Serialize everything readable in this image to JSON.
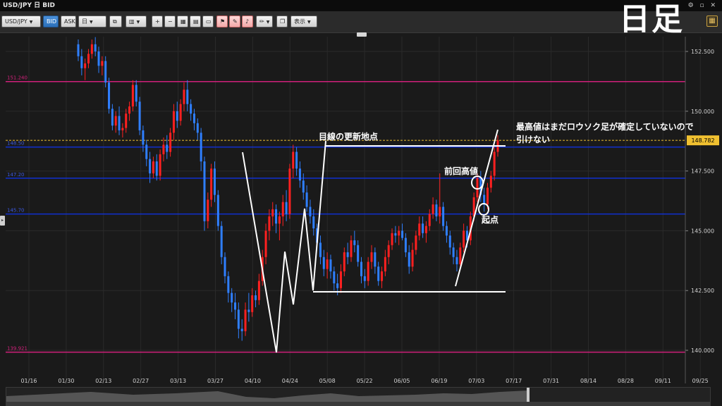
{
  "window": {
    "title": "USD/JPY 日 BID",
    "controls": "⚙ ▫ ✕"
  },
  "toolbar": {
    "pair": "USD/JPY",
    "bid": "BID",
    "ask": "ASK",
    "timeframe": "日",
    "display_label": "表示"
  },
  "corner_label": "日足",
  "annotations": {
    "note_line1": "最高値はまだロウソク足が確定していないので",
    "note_line2": "引けない",
    "update_point": "目線の更新地点",
    "prev_high": "前回高値",
    "start_point": "起点"
  },
  "colors": {
    "background": "#1a1a1a",
    "grid": "#2a2a2a",
    "bull": "#ff2020",
    "bear": "#2f7fff",
    "magenta_line": "#d0207a",
    "blue_line": "#1030d0",
    "current_price": "#f0c030",
    "drawing": "#ffffff"
  },
  "chart_data": {
    "type": "candlestick",
    "symbol": "USD/JPY",
    "timeframe": "日",
    "y_axis": {
      "ticks": [
        "152.500",
        "150.000",
        "147.500",
        "145.000",
        "142.500",
        "140.000"
      ],
      "range": [
        139.0,
        153.2
      ]
    },
    "x_axis": {
      "ticks": [
        "01/16",
        "01/30",
        "02/13",
        "02/27",
        "03/13",
        "03/27",
        "04/10",
        "04/24",
        "05/08",
        "05/22",
        "06/05",
        "06/19",
        "07/03",
        "07/17",
        "07/31",
        "08/14",
        "08/28",
        "09/11",
        "09/25"
      ]
    },
    "horizontal_lines": [
      {
        "label": "151.240",
        "value": 151.24,
        "color": "magenta"
      },
      {
        "label": "148.782",
        "value": 148.782,
        "color": "current-price"
      },
      {
        "label": "148.50",
        "value": 148.5,
        "color": "blue"
      },
      {
        "label": "147.20",
        "value": 147.2,
        "color": "blue"
      },
      {
        "label": "145.70",
        "value": 145.7,
        "color": "blue"
      },
      {
        "label": "139.921",
        "value": 139.921,
        "color": "magenta"
      }
    ],
    "current_price": "148.782",
    "candles_ohlc": [
      [
        152.8,
        153.0,
        152.1,
        152.3
      ],
      [
        152.3,
        152.6,
        151.5,
        151.8
      ],
      [
        151.8,
        152.2,
        151.3,
        152.0
      ],
      [
        152.0,
        152.6,
        151.8,
        152.4
      ],
      [
        152.4,
        153.0,
        152.2,
        152.8
      ],
      [
        152.8,
        153.1,
        152.3,
        152.5
      ],
      [
        152.5,
        152.7,
        151.6,
        151.9
      ],
      [
        151.9,
        152.3,
        151.5,
        152.1
      ],
      [
        152.1,
        152.3,
        151.0,
        151.2
      ],
      [
        151.2,
        151.4,
        149.9,
        150.1
      ],
      [
        150.1,
        150.3,
        149.2,
        149.4
      ],
      [
        149.4,
        150.0,
        149.1,
        149.8
      ],
      [
        149.8,
        150.2,
        149.0,
        149.2
      ],
      [
        149.2,
        149.5,
        148.9,
        149.3
      ],
      [
        149.3,
        150.1,
        149.1,
        149.9
      ],
      [
        149.9,
        150.4,
        149.6,
        150.2
      ],
      [
        150.2,
        151.3,
        150.0,
        151.1
      ],
      [
        151.1,
        151.3,
        150.2,
        150.4
      ],
      [
        150.4,
        150.6,
        149.0,
        149.2
      ],
      [
        149.2,
        149.4,
        148.3,
        148.6
      ],
      [
        148.6,
        148.8,
        147.7,
        148.0
      ],
      [
        148.0,
        148.3,
        147.0,
        147.4
      ],
      [
        147.4,
        148.1,
        147.2,
        147.9
      ],
      [
        147.9,
        148.2,
        147.1,
        147.3
      ],
      [
        147.3,
        148.4,
        147.1,
        148.2
      ],
      [
        148.2,
        148.9,
        147.9,
        148.6
      ],
      [
        148.6,
        149.0,
        148.0,
        148.3
      ],
      [
        148.3,
        149.3,
        148.1,
        149.1
      ],
      [
        149.1,
        150.3,
        148.8,
        150.0
      ],
      [
        150.0,
        150.4,
        149.3,
        149.6
      ],
      [
        149.6,
        150.5,
        149.4,
        150.3
      ],
      [
        150.3,
        151.2,
        150.0,
        150.9
      ],
      [
        150.9,
        151.3,
        150.0,
        150.3
      ],
      [
        150.3,
        150.5,
        149.6,
        149.9
      ],
      [
        149.9,
        150.1,
        149.2,
        149.5
      ],
      [
        149.5,
        149.7,
        148.8,
        149.1
      ],
      [
        149.1,
        149.3,
        147.5,
        147.9
      ],
      [
        147.9,
        148.1,
        145.0,
        145.4
      ],
      [
        145.4,
        146.6,
        145.1,
        146.3
      ],
      [
        146.3,
        147.8,
        146.0,
        147.6
      ],
      [
        147.6,
        147.9,
        146.2,
        146.5
      ],
      [
        146.5,
        146.7,
        145.0,
        145.2
      ],
      [
        145.2,
        145.4,
        143.6,
        143.9
      ],
      [
        143.9,
        144.1,
        142.8,
        143.1
      ],
      [
        143.1,
        143.3,
        142.0,
        142.4
      ],
      [
        142.4,
        142.6,
        141.6,
        142.0
      ],
      [
        142.0,
        142.4,
        141.3,
        141.7
      ],
      [
        141.7,
        142.0,
        140.5,
        140.9
      ],
      [
        140.9,
        141.3,
        140.4,
        140.8
      ],
      [
        140.8,
        142.0,
        140.6,
        141.7
      ],
      [
        141.7,
        142.4,
        141.2,
        141.6
      ],
      [
        141.6,
        142.6,
        141.4,
        142.3
      ],
      [
        142.3,
        142.5,
        141.8,
        142.1
      ],
      [
        142.1,
        143.2,
        141.9,
        142.9
      ],
      [
        142.9,
        144.2,
        142.7,
        143.9
      ],
      [
        143.9,
        145.3,
        143.6,
        145.0
      ],
      [
        145.0,
        145.9,
        144.6,
        145.6
      ],
      [
        145.6,
        146.2,
        145.2,
        145.9
      ],
      [
        145.9,
        146.1,
        144.9,
        145.3
      ],
      [
        145.3,
        145.8,
        144.6,
        145.6
      ],
      [
        145.6,
        146.5,
        145.2,
        146.2
      ],
      [
        146.2,
        146.7,
        145.4,
        145.7
      ],
      [
        145.7,
        147.8,
        145.5,
        147.6
      ],
      [
        147.6,
        148.6,
        147.2,
        148.3
      ],
      [
        148.3,
        148.5,
        147.3,
        147.6
      ],
      [
        147.6,
        147.9,
        146.8,
        147.1
      ],
      [
        147.1,
        147.4,
        146.3,
        146.6
      ],
      [
        146.6,
        146.9,
        145.8,
        146.0
      ],
      [
        146.0,
        146.3,
        145.3,
        145.6
      ],
      [
        145.6,
        145.9,
        144.8,
        145.1
      ],
      [
        145.1,
        145.3,
        144.2,
        144.5
      ],
      [
        144.5,
        144.8,
        143.6,
        143.9
      ],
      [
        143.9,
        144.2,
        143.1,
        143.4
      ],
      [
        143.4,
        144.1,
        143.0,
        143.8
      ],
      [
        143.8,
        144.0,
        143.0,
        143.3
      ],
      [
        143.3,
        143.5,
        142.5,
        142.8
      ],
      [
        142.8,
        143.2,
        142.3,
        142.6
      ],
      [
        142.6,
        143.6,
        142.4,
        143.3
      ],
      [
        143.3,
        144.3,
        143.1,
        144.1
      ],
      [
        144.1,
        144.5,
        143.6,
        143.9
      ],
      [
        143.9,
        144.8,
        143.7,
        144.6
      ],
      [
        144.6,
        145.0,
        144.1,
        144.4
      ],
      [
        144.4,
        144.6,
        143.5,
        143.7
      ],
      [
        143.7,
        143.9,
        142.8,
        143.1
      ],
      [
        143.1,
        143.4,
        142.6,
        142.9
      ],
      [
        142.9,
        143.9,
        142.7,
        143.7
      ],
      [
        143.7,
        144.4,
        143.4,
        144.1
      ],
      [
        144.1,
        144.3,
        143.2,
        143.5
      ],
      [
        143.5,
        143.7,
        142.7,
        142.9
      ],
      [
        142.9,
        143.5,
        142.6,
        143.3
      ],
      [
        143.3,
        144.2,
        143.1,
        143.9
      ],
      [
        143.9,
        144.6,
        143.6,
        144.4
      ],
      [
        144.4,
        145.1,
        144.2,
        144.9
      ],
      [
        144.9,
        145.2,
        144.5,
        144.8
      ],
      [
        144.8,
        145.2,
        144.4,
        145.0
      ],
      [
        145.0,
        145.3,
        144.6,
        144.7
      ],
      [
        144.7,
        144.9,
        143.9,
        144.1
      ],
      [
        144.1,
        144.4,
        143.2,
        143.5
      ],
      [
        143.5,
        144.5,
        143.3,
        144.2
      ],
      [
        144.2,
        145.0,
        144.0,
        144.8
      ],
      [
        144.8,
        145.6,
        144.6,
        145.3
      ],
      [
        145.3,
        145.6,
        144.7,
        144.9
      ],
      [
        144.9,
        145.4,
        144.5,
        145.2
      ],
      [
        145.2,
        145.9,
        145.0,
        145.7
      ],
      [
        145.7,
        146.4,
        145.5,
        146.1
      ],
      [
        146.1,
        146.3,
        145.4,
        145.6
      ],
      [
        145.6,
        147.4,
        145.3,
        146.0
      ],
      [
        146.0,
        146.2,
        145.0,
        145.2
      ],
      [
        145.2,
        145.4,
        144.5,
        144.8
      ],
      [
        144.8,
        145.0,
        144.0,
        144.3
      ],
      [
        144.3,
        144.5,
        143.6,
        143.9
      ],
      [
        143.9,
        144.2,
        143.3,
        143.6
      ],
      [
        143.6,
        144.5,
        143.4,
        144.3
      ],
      [
        144.3,
        145.3,
        144.1,
        145.0
      ],
      [
        145.0,
        145.2,
        144.3,
        144.6
      ],
      [
        144.6,
        145.8,
        144.4,
        145.6
      ],
      [
        145.6,
        146.6,
        145.4,
        146.4
      ],
      [
        146.4,
        147.4,
        146.2,
        147.2
      ],
      [
        147.2,
        147.5,
        146.2,
        146.5
      ],
      [
        146.5,
        146.8,
        145.8,
        146.1
      ],
      [
        146.1,
        147.0,
        145.9,
        146.8
      ],
      [
        146.8,
        147.5,
        146.6,
        147.3
      ],
      [
        147.3,
        148.5,
        147.1,
        148.3
      ],
      [
        148.3,
        149.0,
        148.1,
        148.782
      ]
    ]
  }
}
